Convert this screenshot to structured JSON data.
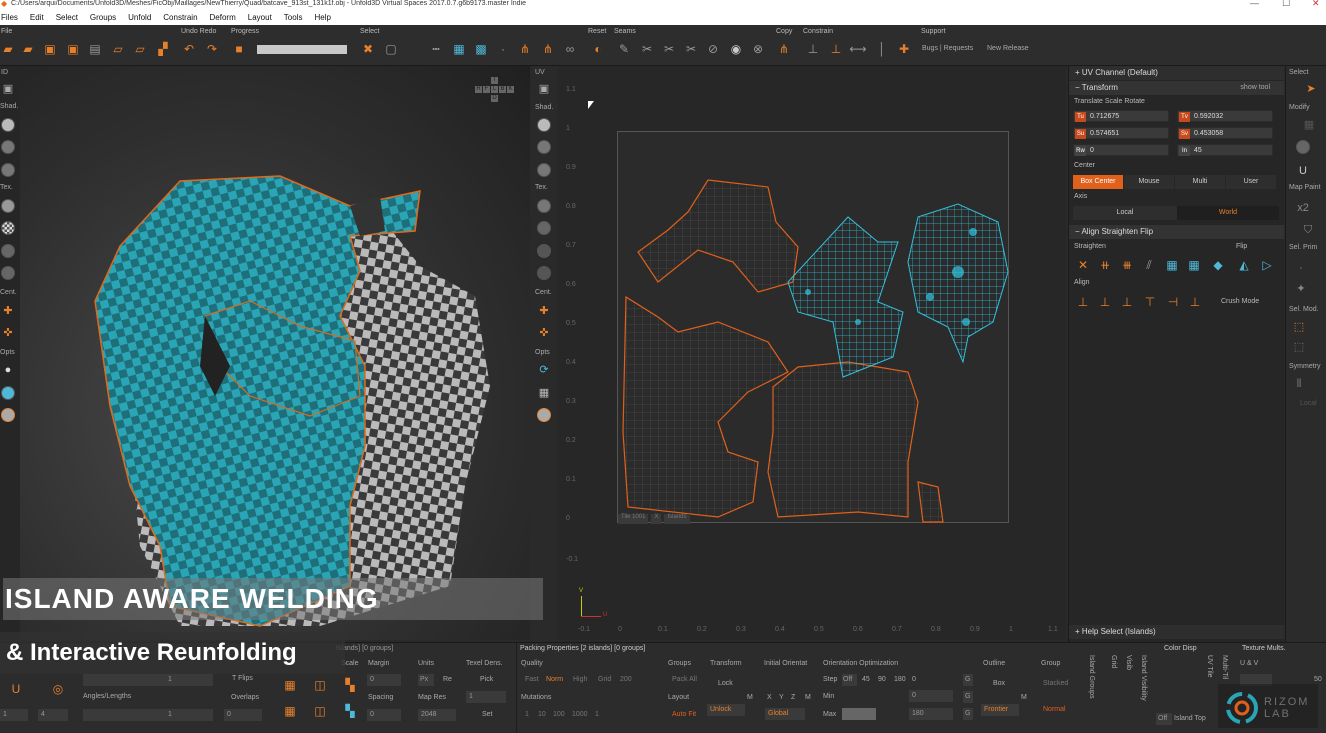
{
  "window": {
    "title": "C:/Users/arqui/Documents/Unfold3D/Meshes/FicObj/Maillages/NewThierry/Quad/batcave_913st_131k1f.obj - Unfold3D Virtual Spaces 2017.0.7.g6b9173.master Indie"
  },
  "menu": [
    "Files",
    "Edit",
    "Select",
    "Groups",
    "Unfold",
    "Constrain",
    "Deform",
    "Layout",
    "Tools",
    "Help"
  ],
  "toolbar": {
    "groups": {
      "file": "File",
      "undo_redo": "Undo Redo",
      "progress": "Progress",
      "select": "Select",
      "reset": "Reset",
      "seams": "Seams",
      "copy": "Copy",
      "constrain": "Constrain",
      "support": "Support"
    },
    "links": {
      "bugs": "Bugs | Requests",
      "new_release": "New Release"
    }
  },
  "left_strip": {
    "id": "ID",
    "shad": "Shad.",
    "tex": "Tex.",
    "cent": "Cent.",
    "opts": "Opts"
  },
  "mid_strip": {
    "uv": "UV",
    "shad": "Shad.",
    "tex": "Tex.",
    "cent": "Cent.",
    "opts": "Opts"
  },
  "viewcube": {
    "letters": [
      "T",
      "R",
      "F",
      "L",
      "B",
      "K",
      "D"
    ]
  },
  "uv_axis": {
    "y_ticks": [
      "1.1",
      "1",
      "0.9",
      "0.8",
      "0.7",
      "0.6",
      "0.5",
      "0.4",
      "0.3",
      "0.2",
      "0.1",
      "0",
      "-0.1"
    ],
    "x_ticks": [
      "-0.1",
      "0",
      "0.1",
      "0.2",
      "0.3",
      "0.4",
      "0.5",
      "0.6",
      "0.7",
      "0.8",
      "0.9",
      "1",
      "1.1"
    ],
    "tile_info": {
      "tile": "Tile 1001",
      "sep": "X",
      "islands": "Islands"
    },
    "v": "V",
    "u": "U"
  },
  "right_panel": {
    "uv_channel": "UV Channel (Default)",
    "transform": {
      "title": "Transform",
      "show_tool": "show tool",
      "subtitle": "Translate Scale Rotate",
      "tu_label": "Tu",
      "tu": "0.712675",
      "tv_label": "Tv",
      "tv": "0.592032",
      "su_label": "Su",
      "su": "0.574651",
      "sv_label": "Sv",
      "sv": "0.453058",
      "rw_label": "Rw",
      "rw": "0",
      "in_label": "In",
      "in": "45",
      "center_label": "Center",
      "center_options": [
        "Box Center",
        "Mouse",
        "Multi",
        "User"
      ],
      "axis_label": "Axis",
      "axis_options": [
        "Local",
        "World"
      ]
    },
    "align": {
      "title": "Align Straighten Flip",
      "straighten": "Straighten",
      "flip": "Flip",
      "align": "Align",
      "crush_mode": "Crush Mode"
    },
    "help": "Help Select (Islands)"
  },
  "far_right": {
    "select": "Select",
    "modify": "Modify",
    "map_paint": "Map Paint",
    "sel_prim": "Sel. Prim",
    "sel_mod": "Sel. Mod.",
    "symmetry": "Symmetry",
    "local": "Local"
  },
  "bottom": {
    "islands_groups": "Islands] [0 groups]",
    "scale": "Scale",
    "margin": "Margin",
    "units": "Units",
    "texel": "Texel Dens.",
    "px": "Px",
    "re": "Re",
    "pick": "Pick",
    "t_flips": "T Flips",
    "overlaps": "Overlaps",
    "angles": "Angles/Lengths",
    "spacing": "Spacing",
    "map_res": "Map Res",
    "map_res_val": "2048",
    "set": "Set",
    "val1": "1",
    "val0": "0",
    "val4": "4",
    "packing_title": "Packing Properties [2 islands] [0 groups]",
    "quality": "Quality",
    "q_opts": [
      "Fast",
      "Norm",
      "High",
      "Grid",
      "200"
    ],
    "mutations": "Mutations",
    "mut_opts": [
      "1",
      "10",
      "100",
      "1000",
      "1"
    ],
    "groups_label": "Groups",
    "pack_all": "Pack All",
    "layout": "Layout",
    "auto_fit": "Auto Fit",
    "transform": "Transform",
    "lock": "Lock",
    "unlock": "Unlock",
    "m": "M",
    "initial_orient": "Initial Orientat",
    "xyz": [
      "X",
      "Y",
      "Z",
      "M"
    ],
    "global": "Global",
    "orient_opt": "Orientation Optimization",
    "step": "Step",
    "off": "Off",
    "step_vals": [
      "45",
      "90",
      "180",
      "0"
    ],
    "min": "Min",
    "max": "Max",
    "max_val": "180",
    "min_val": "0",
    "g": "G",
    "outline": "Outline",
    "box": "Box",
    "frontier": "Frontier",
    "group": "Group",
    "stacked": "Stacked",
    "normal": "Normal",
    "vertical_tabs": [
      "Island Groups",
      "Grid",
      "Visib",
      "Island Visibility"
    ],
    "color_disp": "Color Disp",
    "uv_tile": "UV Tile",
    "multi_tile": "Multi-Til",
    "texture_mults": "Texture Mults.",
    "u_v": "U & V",
    "val50": "50",
    "off_label": "Off",
    "island_top": "Island Top"
  },
  "brand": {
    "name": "RIZOM LAB"
  },
  "captions": {
    "line1": "ISLAND AWARE WELDING",
    "line2": "& Interactive Reunfolding"
  },
  "colors": {
    "accent": "#e8802a",
    "teal": "#2aa5b5",
    "uv_highlight": "#33c8e6",
    "orange_outline": "#e0601c"
  }
}
